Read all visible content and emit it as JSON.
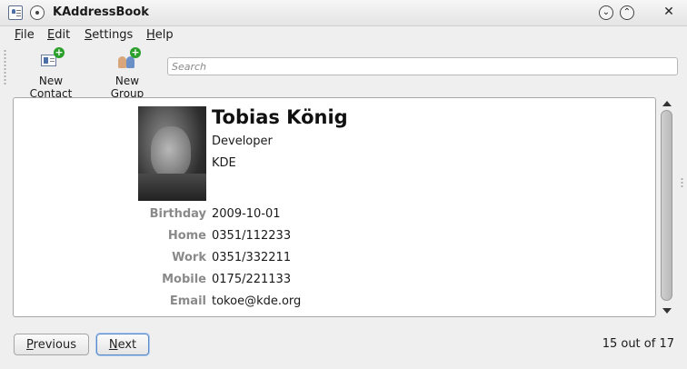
{
  "window": {
    "title": "KAddressBook"
  },
  "menu": {
    "file": {
      "mnemonic": "F",
      "rest": "ile"
    },
    "edit": {
      "mnemonic": "E",
      "rest": "dit"
    },
    "settings": {
      "mnemonic": "S",
      "rest": "ettings"
    },
    "help": {
      "mnemonic": "H",
      "rest": "elp"
    }
  },
  "toolbar": {
    "new_contact": "New Contact",
    "new_group": "New Group",
    "icons": [
      "new-contact-icon",
      "new-group-icon"
    ]
  },
  "search": {
    "placeholder": "Search",
    "value": ""
  },
  "contact": {
    "name": "Tobias König",
    "role": "Developer",
    "organization": "KDE",
    "fields": [
      {
        "label": "Birthday",
        "value": "2009-10-01"
      },
      {
        "label": "Home",
        "value": "0351/112233"
      },
      {
        "label": "Work",
        "value": "0351/332211"
      },
      {
        "label": "Mobile",
        "value": "0175/221133"
      },
      {
        "label": "Email",
        "value": "tokoe@kde.org"
      }
    ]
  },
  "navigation": {
    "previous": {
      "mnemonic": "P",
      "rest": "revious"
    },
    "next": {
      "mnemonic": "N",
      "rest": "ext"
    },
    "counter": "15 out of 17"
  },
  "colors": {
    "label_gray": "#8a8a8a",
    "focus_blue": "#5a8ac8",
    "plus_green": "#2aa02a"
  }
}
